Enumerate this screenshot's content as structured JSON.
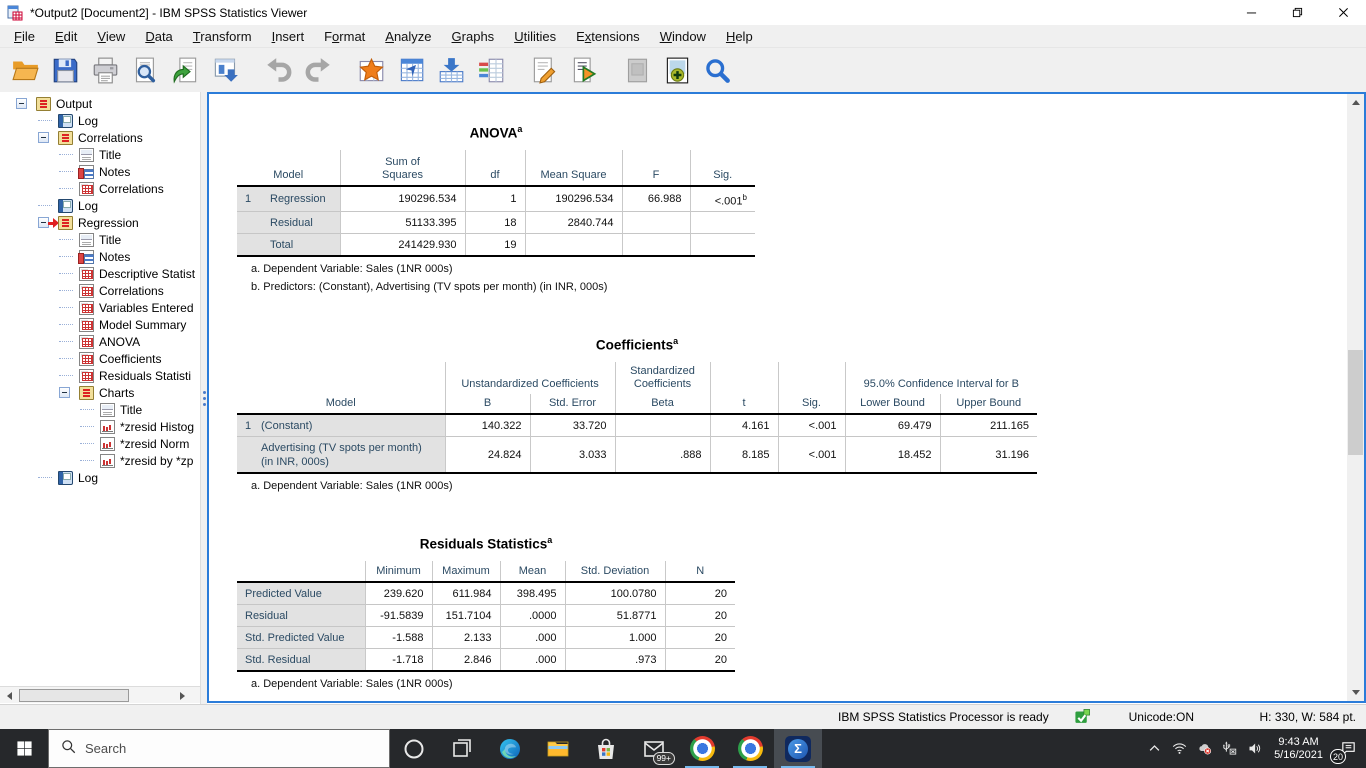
{
  "window": {
    "title": "*Output2 [Document2] - IBM SPSS Statistics Viewer"
  },
  "menu": {
    "items": [
      {
        "pre": "",
        "m": "F",
        "post": "ile"
      },
      {
        "pre": "",
        "m": "E",
        "post": "dit"
      },
      {
        "pre": "",
        "m": "V",
        "post": "iew"
      },
      {
        "pre": "",
        "m": "D",
        "post": "ata"
      },
      {
        "pre": "",
        "m": "T",
        "post": "ransform"
      },
      {
        "pre": "",
        "m": "I",
        "post": "nsert"
      },
      {
        "pre": "F",
        "m": "o",
        "post": "rmat"
      },
      {
        "pre": "",
        "m": "A",
        "post": "nalyze"
      },
      {
        "pre": "",
        "m": "G",
        "post": "raphs"
      },
      {
        "pre": "",
        "m": "U",
        "post": "tilities"
      },
      {
        "pre": "E",
        "m": "x",
        "post": "tensions"
      },
      {
        "pre": "",
        "m": "W",
        "post": "indow"
      },
      {
        "pre": "",
        "m": "H",
        "post": "elp"
      }
    ]
  },
  "toolbar": {
    "buttons": [
      {
        "name": "open"
      },
      {
        "name": "save"
      },
      {
        "name": "print"
      },
      {
        "name": "print-preview"
      },
      {
        "name": "export"
      },
      {
        "name": "paste-output"
      },
      {
        "name": "undo",
        "gap": 1
      },
      {
        "name": "redo"
      },
      {
        "name": "recall-dialogs",
        "gap": 1
      },
      {
        "name": "goto-data"
      },
      {
        "name": "goto-case"
      },
      {
        "name": "variables"
      },
      {
        "name": "insert-syntax",
        "gap": 1
      },
      {
        "name": "run-script"
      },
      {
        "name": "select-last-output",
        "gap": 1,
        "disabled": 1
      },
      {
        "name": "designate-window"
      },
      {
        "name": "find"
      }
    ]
  },
  "tree": {
    "items": [
      {
        "label": "Output",
        "depth": 0,
        "icon": "book",
        "box": "on",
        "st": "off",
        "arrow": ""
      },
      {
        "label": "Log",
        "depth": 1,
        "icon": "log",
        "box": "",
        "st": "",
        "arrow": ""
      },
      {
        "label": "Correlations",
        "depth": 1,
        "icon": "book",
        "box": "on",
        "st": "off",
        "arrow": ""
      },
      {
        "label": "Title",
        "depth": 2,
        "icon": "title",
        "box": "",
        "st": "",
        "arrow": ""
      },
      {
        "label": "Notes",
        "depth": 2,
        "icon": "notes",
        "box": "",
        "st": "",
        "arrow": ""
      },
      {
        "label": "Correlations",
        "depth": 2,
        "icon": "table",
        "box": "",
        "st": "",
        "arrow": ""
      },
      {
        "label": "Log",
        "depth": 1,
        "icon": "log",
        "box": "",
        "st": "",
        "arrow": ""
      },
      {
        "label": "Regression",
        "depth": 1,
        "icon": "book",
        "box": "on",
        "st": "off",
        "arrow": "on"
      },
      {
        "label": "Title",
        "depth": 2,
        "icon": "title",
        "box": "",
        "st": "",
        "arrow": ""
      },
      {
        "label": "Notes",
        "depth": 2,
        "icon": "notes",
        "box": "",
        "st": "",
        "arrow": ""
      },
      {
        "label": "Descriptive Statist",
        "depth": 2,
        "icon": "table",
        "box": "",
        "st": "",
        "arrow": ""
      },
      {
        "label": "Correlations",
        "depth": 2,
        "icon": "table",
        "box": "",
        "st": "",
        "arrow": ""
      },
      {
        "label": "Variables Entered",
        "depth": 2,
        "icon": "table",
        "box": "",
        "st": "",
        "arrow": ""
      },
      {
        "label": "Model Summary",
        "depth": 2,
        "icon": "table",
        "box": "",
        "st": "",
        "arrow": ""
      },
      {
        "label": "ANOVA",
        "depth": 2,
        "icon": "table",
        "box": "",
        "st": "",
        "arrow": ""
      },
      {
        "label": "Coefficients",
        "depth": 2,
        "icon": "table",
        "box": "",
        "st": "",
        "arrow": ""
      },
      {
        "label": "Residuals Statisti",
        "depth": 2,
        "icon": "table",
        "box": "",
        "st": "",
        "arrow": ""
      },
      {
        "label": "Charts",
        "depth": 2,
        "icon": "book",
        "box": "on",
        "st": "off",
        "arrow": ""
      },
      {
        "label": "Title",
        "depth": 3,
        "icon": "title",
        "box": "",
        "st": "",
        "arrow": ""
      },
      {
        "label": "*zresid Histog",
        "depth": 3,
        "icon": "chart",
        "box": "",
        "st": "",
        "arrow": ""
      },
      {
        "label": "*zresid Norm",
        "depth": 3,
        "icon": "chart",
        "box": "",
        "st": "",
        "arrow": ""
      },
      {
        "label": "*zresid by *zp",
        "depth": 3,
        "icon": "chart",
        "box": "",
        "st": "",
        "arrow": ""
      },
      {
        "label": "Log",
        "depth": 1,
        "icon": "log",
        "box": "",
        "st": "",
        "arrow": ""
      }
    ]
  },
  "tables": {
    "anova": {
      "title": "ANOVA",
      "title_sup": "a",
      "col_headers": [
        "Model",
        "Sum of Squares",
        "df",
        "Mean Square",
        "F",
        "Sig."
      ],
      "rows": [
        {
          "c0": "1",
          "c1": "Regression",
          "c2": "190296.534",
          "c3": "1",
          "c4": "190296.534",
          "c5": "66.988",
          "c6": "<.001",
          "s6": "b"
        },
        {
          "c0": "",
          "c1": "Residual",
          "c2": "51133.395",
          "c3": "18",
          "c4": "2840.744",
          "c5": "",
          "c6": "",
          "s6": ""
        },
        {
          "c0": "",
          "c1": "Total",
          "c2": "241429.930",
          "c3": "19",
          "c4": "",
          "c5": "",
          "c6": "",
          "s6": ""
        }
      ],
      "footnotes": [
        "a. Dependent Variable: Sales (1NR 000s)",
        "b. Predictors: (Constant), Advertising (TV spots per month) (in INR, 000s)"
      ]
    },
    "coefficients": {
      "title": "Coefficients",
      "title_sup": "a",
      "group_headers": [
        "Unstandardized Coefficients",
        "Standardized Coefficients",
        "95.0% Confidence Interval for B"
      ],
      "col_headers": [
        "Model",
        "B",
        "Std. Error",
        "Beta",
        "t",
        "Sig.",
        "Lower Bound",
        "Upper Bound"
      ],
      "rows": [
        {
          "c0": "1",
          "c1": "(Constant)",
          "c2": "140.322",
          "c3": "33.720",
          "c4": "",
          "c5": "4.161",
          "c6": "<.001",
          "c7": "69.479",
          "c8": "211.165"
        },
        {
          "c0": "",
          "c1": "Advertising (TV spots per month) (in INR, 000s)",
          "c2": "24.824",
          "c3": "3.033",
          "c4": ".888",
          "c5": "8.185",
          "c6": "<.001",
          "c7": "18.452",
          "c8": "31.196"
        }
      ],
      "footnotes": [
        "a. Dependent Variable: Sales (1NR 000s)"
      ]
    },
    "residuals": {
      "title": "Residuals Statistics",
      "title_sup": "a",
      "col_headers": [
        "Minimum",
        "Maximum",
        "Mean",
        "Std. Deviation",
        "N"
      ],
      "rows": [
        {
          "c0": "Predicted Value",
          "c1": "239.620",
          "c2": "611.984",
          "c3": "398.495",
          "c4": "100.0780",
          "c5": "20"
        },
        {
          "c0": "Residual",
          "c1": "-91.5839",
          "c2": "151.7104",
          "c3": ".0000",
          "c4": "51.8771",
          "c5": "20"
        },
        {
          "c0": "Std. Predicted Value",
          "c1": "-1.588",
          "c2": "2.133",
          "c3": ".000",
          "c4": "1.000",
          "c5": "20"
        },
        {
          "c0": "Std. Residual",
          "c1": "-1.718",
          "c2": "2.846",
          "c3": ".000",
          "c4": ".973",
          "c5": "20"
        }
      ],
      "footnotes": [
        "a. Dependent Variable: Sales (1NR 000s)"
      ]
    }
  },
  "status": {
    "processor": "IBM SPSS Statistics Processor is ready",
    "unicode": "Unicode:ON",
    "dimensions": "H: 330, W: 584 pt."
  },
  "taskbar": {
    "search_placeholder": "Search",
    "apps": [
      {
        "name": "cortana"
      },
      {
        "name": "task-view"
      },
      {
        "name": "edge"
      },
      {
        "name": "file-explorer"
      },
      {
        "name": "microsoft-store"
      },
      {
        "name": "mail",
        "badge": "99+"
      },
      {
        "name": "chrome",
        "open": 1
      },
      {
        "name": "chrome-2",
        "open": 1
      },
      {
        "name": "spss",
        "open": 1,
        "focused": 1
      }
    ],
    "tray": [
      {
        "name": "tray-expand"
      },
      {
        "name": "wifi"
      },
      {
        "name": "onedrive"
      },
      {
        "name": "usb-eject"
      },
      {
        "name": "volume"
      }
    ],
    "clock_time": "9:43 AM",
    "clock_date": "5/16/2021",
    "action_badge": "20"
  }
}
